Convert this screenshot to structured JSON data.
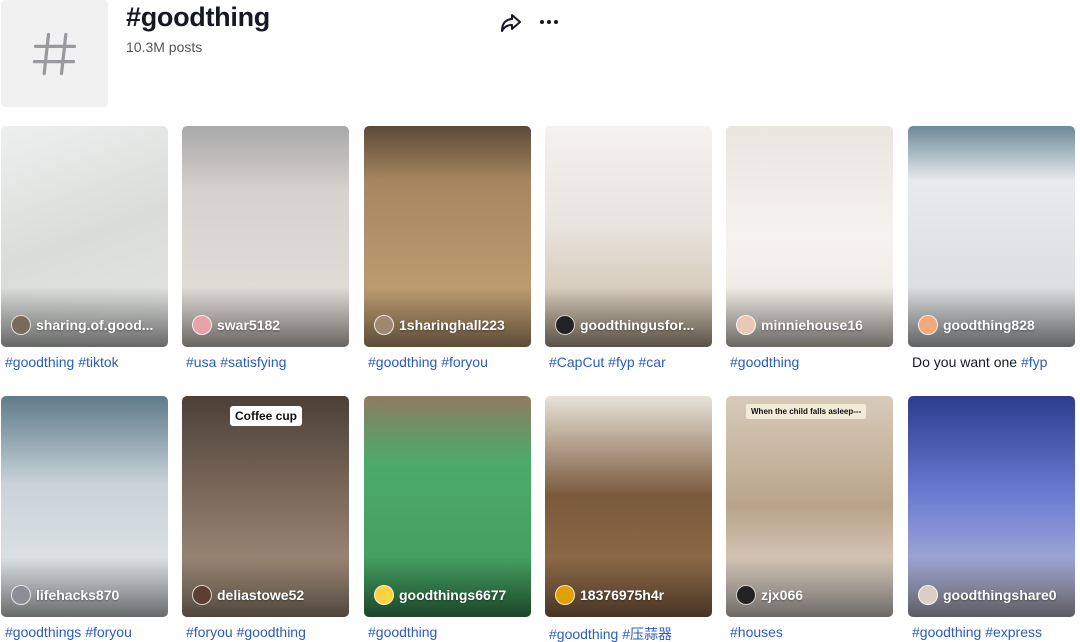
{
  "header": {
    "title": "#goodthing",
    "posts": "10.3M posts",
    "icons": {
      "thumb": "hashtag-icon",
      "share": "share-arrow-icon",
      "more": "more-dots-icon"
    }
  },
  "videos": [
    {
      "author": "sharing.of.good...",
      "caption": [
        "#goodthing",
        " ",
        "#tiktok"
      ],
      "avatar_color": "#7a6a5a"
    },
    {
      "author": "swar5182",
      "caption": [
        "#usa",
        " ",
        "#satisfying"
      ],
      "avatar_color": "#e8a3a8"
    },
    {
      "author": "1sharinghall223",
      "caption": [
        "#goodthing",
        " ",
        "#foryou"
      ],
      "avatar_color": "#a08870"
    },
    {
      "author": "goodthingusfor...",
      "caption": [
        "#CapCut",
        " ",
        "#fyp",
        " ",
        "#car"
      ],
      "avatar_color": "#222222"
    },
    {
      "author": "minniehouse16",
      "caption": [
        "#goodthing"
      ],
      "avatar_color": "#e7c9b6"
    },
    {
      "author": "goodthing828",
      "caption": [
        "Do you want one ",
        "#fyp"
      ],
      "avatar_color": "#f2a97a"
    },
    {
      "author": "lifehacks870",
      "caption": [
        "#goodthings",
        " ",
        "#foryou"
      ],
      "avatar_color": "#8a8f96"
    },
    {
      "author": "deliastowe52",
      "caption": [
        "#foryou",
        " ",
        "#goodthing"
      ],
      "avatar_color": "#5a3d33"
    },
    {
      "author": "goodthings6677",
      "caption": [
        "#goodthing"
      ],
      "avatar_color": "#ffd23f"
    },
    {
      "author": "18376975h4r",
      "caption": [
        "#goodthing",
        " ",
        "#压蒜器"
      ],
      "avatar_color": "#e0a100"
    },
    {
      "author": "zjx066",
      "caption": [
        "#houses"
      ],
      "avatar_color": "#222222"
    },
    {
      "author": "goodthingshare0",
      "caption": [
        "#goodthing",
        " ",
        "#express"
      ],
      "avatar_color": "#d9cfc5"
    }
  ],
  "overlay_text": {
    "coffee_label": "Coffee cup",
    "sleep_label": "When the child falls asleep---"
  }
}
